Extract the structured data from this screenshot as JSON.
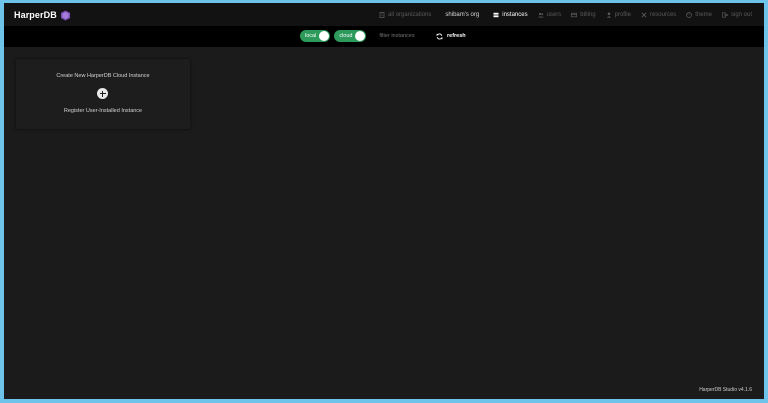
{
  "app": {
    "logo_text": "HarperDB"
  },
  "nav": {
    "all_organizations": "all organizations",
    "org_name": "shibam's org",
    "instances": "instances",
    "users": "users",
    "billing": "billing",
    "profile": "profile",
    "resources": "resources",
    "theme": "theme",
    "sign_out": "sign out"
  },
  "toolbar": {
    "local_label": "local",
    "cloud_label": "cloud",
    "filter_placeholder": "filter instances",
    "refresh_label": "refresh"
  },
  "card": {
    "create_label": "Create New HarperDB Cloud Instance",
    "register_label": "Register User-Installed Instance"
  },
  "footer": {
    "version": "HarperDB Studio v4.1.6"
  },
  "colors": {
    "page_bg": "#1b1b1b",
    "topnav_bg": "#121212",
    "toggle_green": "#2d9a5c",
    "outer_border": "#6ec3ea",
    "logo_purple": "#7b4fb5"
  }
}
